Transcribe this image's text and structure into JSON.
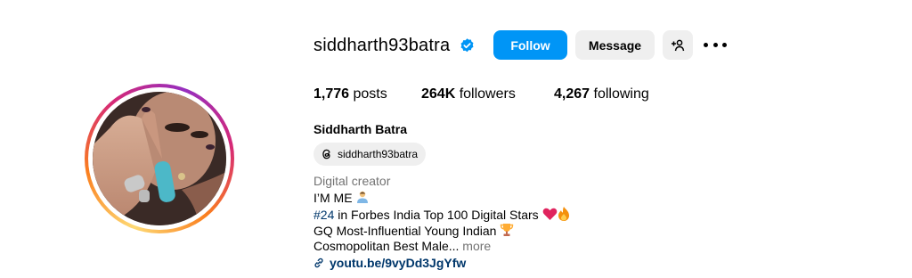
{
  "profile": {
    "username": "siddharth93batra",
    "full_name": "Siddharth Batra",
    "threads_handle": "siddharth93batra",
    "category": "Digital creator"
  },
  "actions": {
    "follow_label": "Follow",
    "message_label": "Message"
  },
  "stats": {
    "posts_count": "1,776",
    "posts_label": " posts",
    "followers_count": "264K",
    "followers_label": " followers",
    "following_count": "4,267",
    "following_label": " following"
  },
  "bio": {
    "line1": "I’M ME",
    "line2_hashtag": "#24",
    "line2_text": " in Forbes India Top 100 Digital Stars",
    "line3": "GQ Most-Influential Young Indian",
    "line4": "Cosmopolitan Best Male...",
    "more_label": " more",
    "link": "youtu.be/9vyDd3JgYfw"
  },
  "colors": {
    "accent": "#0095f6",
    "secondary_button": "#efefef",
    "link": "#00376b",
    "muted": "#737373"
  }
}
